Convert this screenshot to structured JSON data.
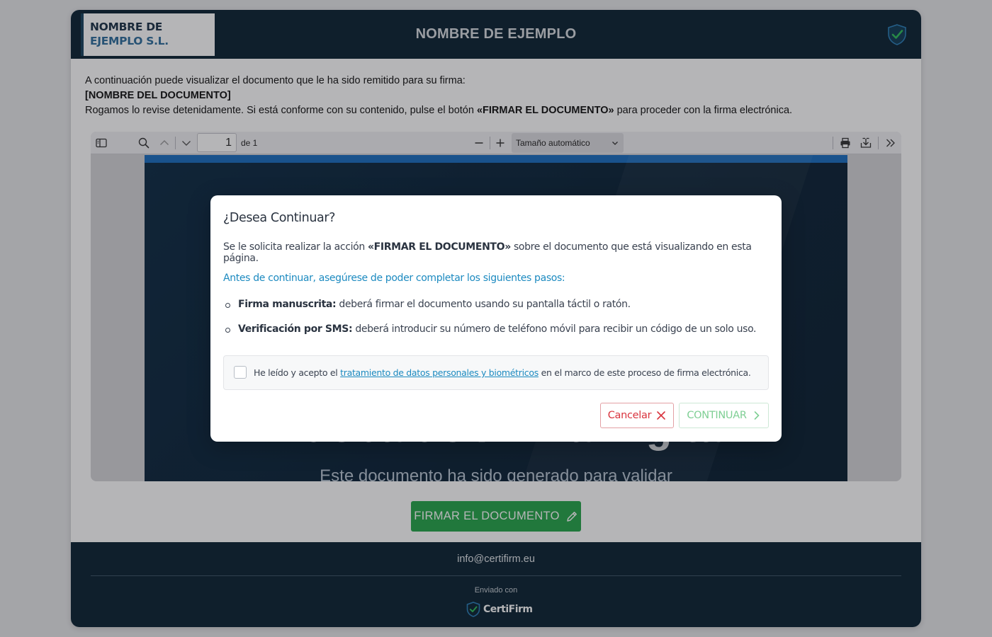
{
  "header": {
    "logo_line1": "NOMBRE DE",
    "logo_line2": "EJEMPLO S.L.",
    "title": "NOMBRE DE EJEMPLO"
  },
  "intro": {
    "line1": "A continuación puede visualizar el documento que le ha sido remitido para su firma:",
    "document_name": "[NOMBRE DEL DOCUMENTO]",
    "line3_before": "Rogamos lo revise detenidamente. Si está conforme con su contenido, pulse el botón ",
    "line3_bold": "«FIRMAR EL DOCUMENTO»",
    "line3_after": " para proceder con la firma electrónica."
  },
  "viewer": {
    "page_number": "1",
    "page_of": "de 1",
    "zoom": "Tamaño automático",
    "pdf_title": "Prueba de Firma Digital",
    "pdf_subtitle": "Este documento ha sido generado para validar"
  },
  "sign_button": {
    "label": "FIRMAR EL DOCUMENTO"
  },
  "footer": {
    "email": "info@certifirm.eu",
    "sent_with": "Enviado con",
    "brand": "CertiFirm"
  },
  "modal": {
    "title": "¿Desea Continuar?",
    "text_before": "Se le solicita realizar la acción ",
    "text_bold": "«FIRMAR EL DOCUMENTO»",
    "text_after": " sobre el documento que está visualizando en esta página.",
    "subtitle": "Antes de continuar, asegúrese de poder completar los siguientes pasos:",
    "steps": [
      {
        "title": "Firma manuscrita:",
        "text": " deberá firmar el documento usando su pantalla táctil o ratón."
      },
      {
        "title": "Verificación por SMS:",
        "text": " deberá introducir su número de teléfono móvil para recibir un código de un solo uso."
      }
    ],
    "consent_before": "He leído y acepto el ",
    "consent_link": "tratamiento de datos personales y biométricos",
    "consent_after": " en el marco de este proceso de firma electrónica.",
    "consent_checked": false,
    "cancel_label": "Cancelar",
    "continue_label": "CONTINUAR"
  },
  "colors": {
    "header_bg": "#0b2333",
    "accent_blue": "#1c8ac0",
    "sign_green": "#25a64a",
    "cancel_red": "#d9343e",
    "continue_green_disabled": "#7fcf94"
  },
  "icons": {
    "header": "shield-check-icon",
    "sidebar_toggle": "sidebar-toggle-icon",
    "search": "search-icon",
    "prev": "chevron-up-icon",
    "next": "chevron-down-icon",
    "zoom_out": "minus-icon",
    "zoom_in": "plus-icon",
    "print": "printer-icon",
    "download": "download-icon",
    "tools": "double-chevron-right-icon",
    "sign": "pencil-icon",
    "cancel": "close-icon",
    "continue": "chevron-right-icon"
  }
}
